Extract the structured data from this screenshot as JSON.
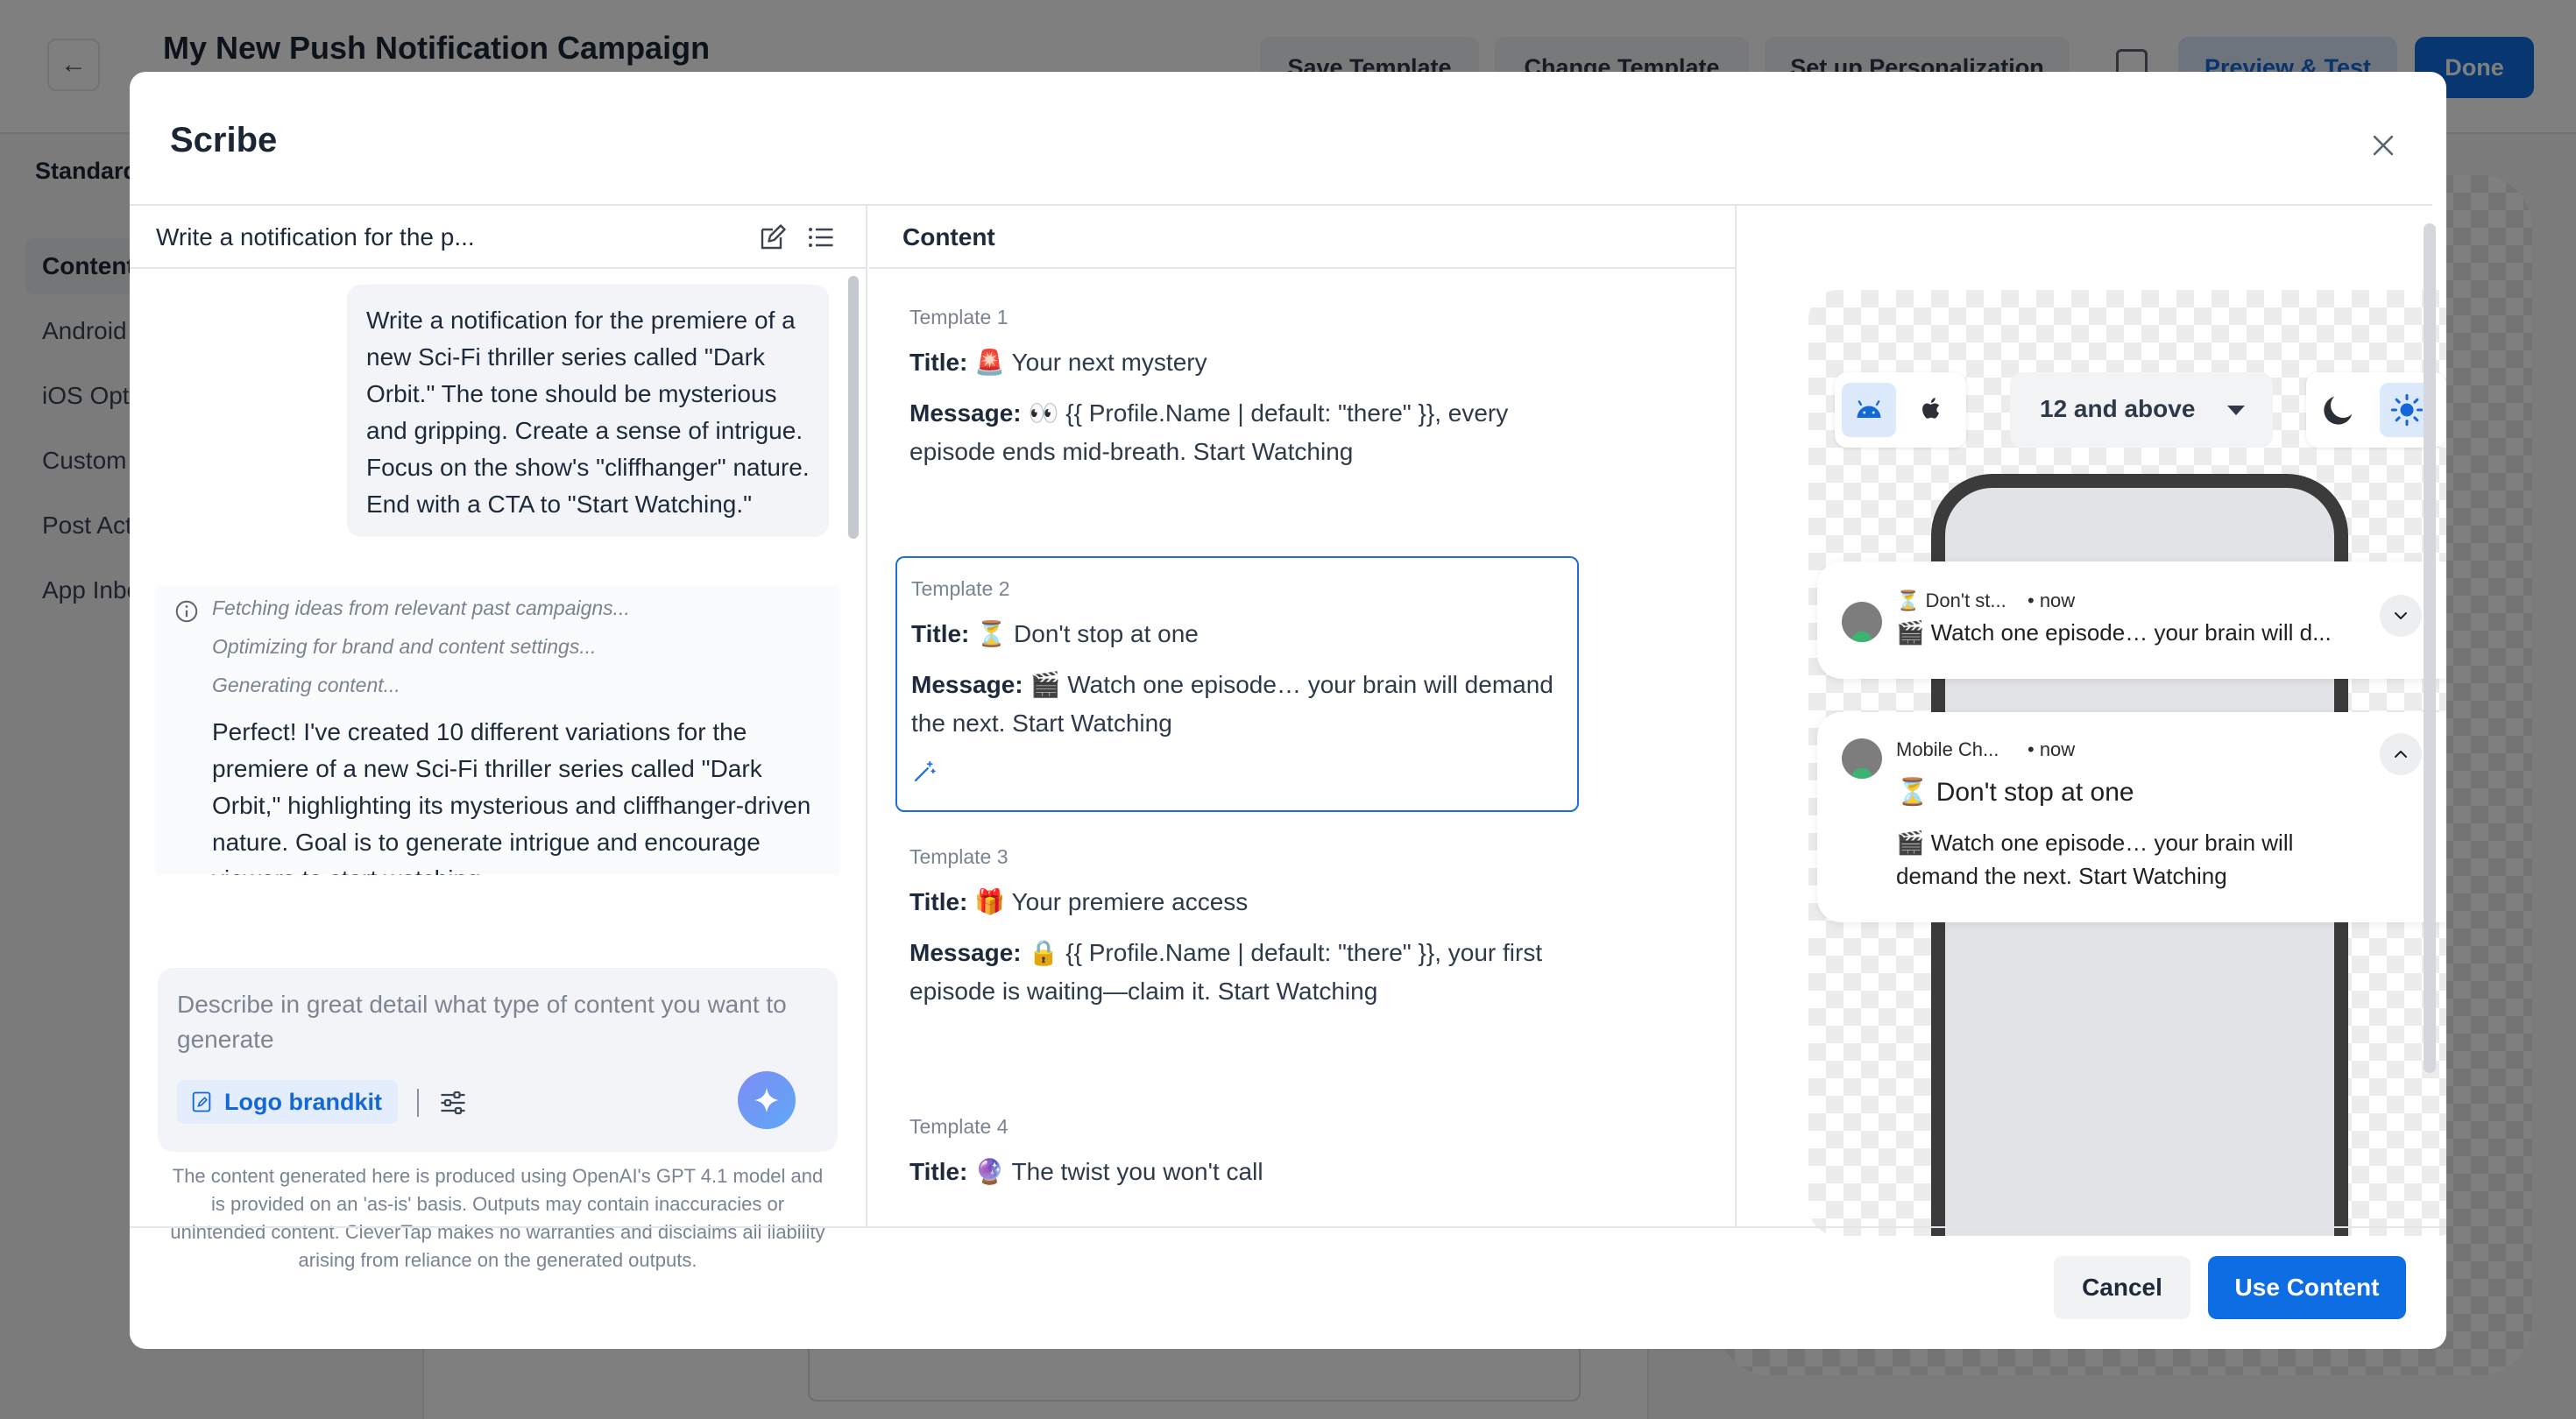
{
  "background": {
    "title": "My New Push Notification Campaign",
    "actions": {
      "save_template": "Save Template",
      "change_template": "Change Template",
      "setup_personalization": "Set up Personalization",
      "preview_test": "Preview & Test",
      "done": "Done"
    },
    "sidebar": {
      "heading": "Standard",
      "items": [
        "Content",
        "Android",
        "iOS Opt",
        "Custom",
        "Post Act",
        "App Inbo"
      ]
    }
  },
  "modal": {
    "title": "Scribe",
    "chat": {
      "header_title": "Write a notification for the p...",
      "user_prompt": "Write a notification for the premiere of a new Sci-Fi thriller series called \"Dark Orbit.\" The tone should be mysterious and gripping. Create a sense of intrigue. Focus on the show's \"cliffhanger\" nature. End with a CTA to \"Start Watching.\"",
      "steps": [
        "Fetching ideas from relevant past campaigns...",
        "Optimizing for brand and content settings...",
        "Generating content..."
      ],
      "response": "Perfect! I've created 10 different variations for the premiere of a new Sci-Fi thriller series called \"Dark Orbit,\" highlighting its mysterious and cliffhanger-driven nature. Goal is to generate intrigue and encourage viewers to start watching."
    },
    "composer": {
      "placeholder": "Describe in great detail what type of content you want to generate",
      "brandkit_label": "Logo brandkit"
    },
    "disclaimer": "The content generated here is produced using OpenAI's GPT 4.1 model and is provided on an 'as-is' basis. Outputs may contain inaccuracies or unintended content. CleverTap makes no warranties and disclaims all liability arising from reliance on the generated outputs.",
    "content": {
      "header_title": "Content",
      "title_key": "Title:",
      "message_key": "Message:",
      "templates": [
        {
          "name": "Template 1",
          "title": "🚨 Your next mystery",
          "message": "👀 {{ Profile.Name | default: \"there\" }}, every episode ends mid-breath. Start Watching"
        },
        {
          "name": "Template 2",
          "title": "⏳ Don't stop at one",
          "message": "🎬 Watch one episode… your brain will demand the next. Start Watching"
        },
        {
          "name": "Template 3",
          "title": "🎁 Your premiere access",
          "message": "🔒 {{ Profile.Name | default: \"there\" }}, your first episode is waiting—claim it. Start Watching"
        },
        {
          "name": "Template 4",
          "title": "🔮 The twist you won't call",
          "message": ""
        }
      ]
    },
    "preview": {
      "version": "12 and above",
      "collapsed": {
        "app": "⏳ Don't st...",
        "time": "• now",
        "body": "🎬 Watch one episode… your brain will d..."
      },
      "expanded": {
        "app": "Mobile Ch...",
        "time": "• now",
        "title": "⏳ Don't stop at one",
        "message": "🎬 Watch one episode… your brain will demand the next. Start Watching"
      }
    },
    "footer": {
      "cancel": "Cancel",
      "use_content": "Use Content"
    }
  }
}
